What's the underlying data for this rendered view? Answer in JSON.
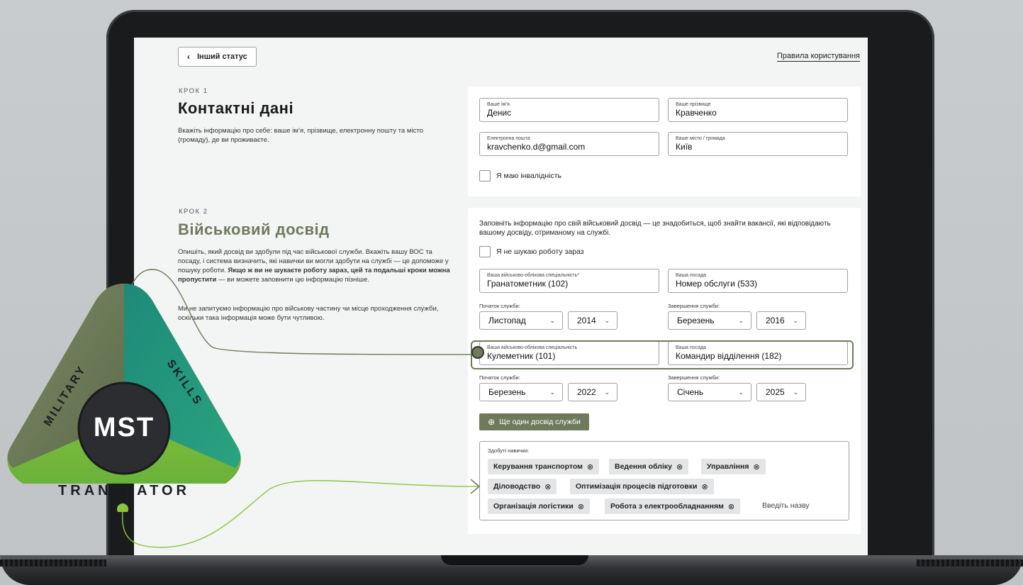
{
  "header": {
    "back_label": "Інший статус",
    "terms_link": "Правила користування"
  },
  "step1": {
    "step_label": "КРОК 1",
    "title": "Контактні дані",
    "description": "Вкажіть інформацію про себе: ваше ім’я, прізвище, електронну пошту та місто (громаду), де ви проживаєте.",
    "fields": [
      {
        "label": "Ваше ім’я",
        "value": "Денис"
      },
      {
        "label": "Ваше прізвище",
        "value": "Кравченко"
      },
      {
        "label": "Електронна пошта",
        "value": "kravchenko.d@gmail.com"
      },
      {
        "label": "Ваше місто / громада",
        "value": "Київ"
      }
    ],
    "disability_checkbox": "Я маю інвалідність"
  },
  "step2": {
    "step_label": "КРОК 2",
    "title": "Військовий досвід",
    "description_p1_a": "Опишіть, який досвід ви здобули під час військової служби. Вкажіть вашу ВОС та посаду, і система визначить, які навички ви могли здобути на службі — це допоможе у пошуку роботи.",
    "description_p1_bold": "Якщо ж ви не шукаєте роботу зараз, цей та подальші кроки можна пропустити",
    "description_p1_b": "— ви можете заповнити цю інформацію пізніше.",
    "description_p2": "Ми не запитуємо інформацію про військову частину чи місце проходження служби, оскільки така інформація може бути чутливою.",
    "intro": "Заповніть інформацію про свій військовий досвід — це знадобиться, щоб знайти вакансії, які відповідають вашому досвіду, отриманому на службі.",
    "not_looking_checkbox": "Я не шукаю роботу зараз",
    "experiences": [
      {
        "specialty_label": "Ваша військово-облікова спеціальність*",
        "specialty": "Гранатометник (102)",
        "position_label": "Ваша посада",
        "position": "Номер обслуги (533)",
        "start_label": "Початок служби:",
        "start_month": "Листопад",
        "start_year": "2014",
        "end_label": "Завершення служби:",
        "end_month": "Березень",
        "end_year": "2016"
      },
      {
        "specialty_label": "Ваша військово-облікова спеціальність",
        "specialty": "Кулеметник (101)",
        "position_label": "Ваша посада",
        "position": "Командир відділення (182)",
        "start_label": "Початок служби:",
        "start_month": "Березень",
        "start_year": "2022",
        "end_label": "Завершення служби:",
        "end_month": "Січень",
        "end_year": "2025"
      }
    ],
    "add_button": "Ще один досвід служби",
    "skills_label": "Здобуті навички:",
    "skills": [
      "Керування транспортом",
      "Ведення обліку",
      "Управління",
      "Діловодство",
      "Оптимізація процесів підготовки",
      "Організація логістики",
      "Робота з електрообладнанням"
    ],
    "skills_placeholder": "Введіть назву"
  },
  "logo": {
    "center": "MST",
    "left_word": "MILITARY",
    "right_word": "SKILLS",
    "bottom_word": "TRANSLATOR",
    "colors": {
      "olive": "#6f7a5c",
      "teal": "#1e8a7a",
      "lime": "#8cc63f",
      "dark": "#2b2d30"
    }
  }
}
